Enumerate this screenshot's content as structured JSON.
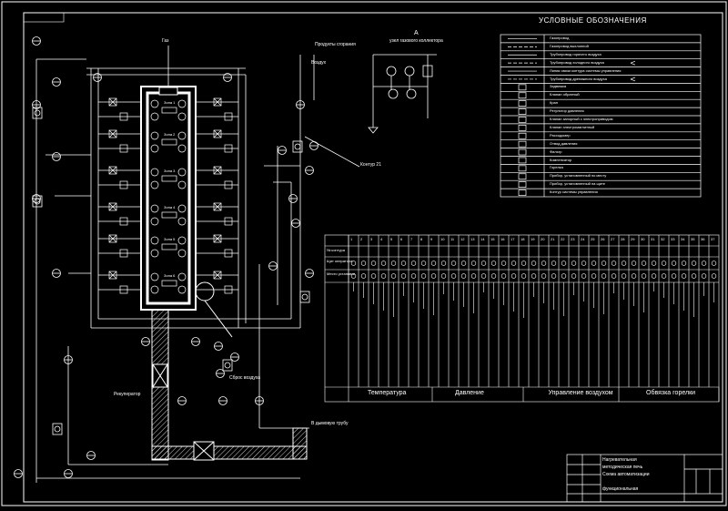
{
  "legend": {
    "title": "Условные обозначения",
    "items": [
      "Газопровод",
      "Газопровод выхлопной",
      "Трубопровод горячего воздуха",
      "Трубопровод холодного воздуха",
      "Линия связи контура системы управления",
      "Трубопровод дренажного воздуха",
      "Задвижка",
      "Клапан обратный",
      "Кран",
      "Регулятор давления",
      "Клапан запорный с электроприводом",
      "Клапан электромагнитный",
      "Расходомер",
      "Отвод давления",
      "Фильтр",
      "Компенсатор",
      "Горелка",
      "Прибор, установленный по месту",
      "Прибор, установленный на щите",
      "Контур системы управления"
    ]
  },
  "zones": [
    "Зона 1",
    "Зона 2",
    "Зона 3",
    "Зона 4",
    "Зона 5",
    "Зона 6"
  ],
  "header_labels": {
    "detail_title": "узел газового коллектора",
    "detail_letter": "А",
    "control_label": "Контур",
    "control_num": "21",
    "gas_supply": "Газ",
    "air_supply": "Воздух",
    "flue": "Продукты сгорания",
    "smoke": "В дымовую трубу",
    "recuperator": "Рекуператор",
    "air_bleed": "Сброс воздуха"
  },
  "table": {
    "row_labels": [
      "№ контура",
      "Щит оператора",
      "Место установки"
    ],
    "columns": [
      "1",
      "2",
      "3",
      "4",
      "5",
      "6",
      "7",
      "8",
      "9",
      "10",
      "11",
      "12",
      "13",
      "14",
      "15",
      "16",
      "17",
      "18",
      "19",
      "20",
      "21",
      "22",
      "23",
      "24",
      "25",
      "26",
      "27",
      "28",
      "29",
      "30",
      "31",
      "32",
      "33",
      "34",
      "35",
      "36",
      "37"
    ],
    "groups": [
      "Температура",
      "Давление",
      "Управление воздухом",
      "Обвязка горелки"
    ]
  },
  "title_block": {
    "line1": "Нагревательная",
    "line2": "методическая печь",
    "line3": "Схема автоматизации",
    "line4": "функциональная"
  }
}
